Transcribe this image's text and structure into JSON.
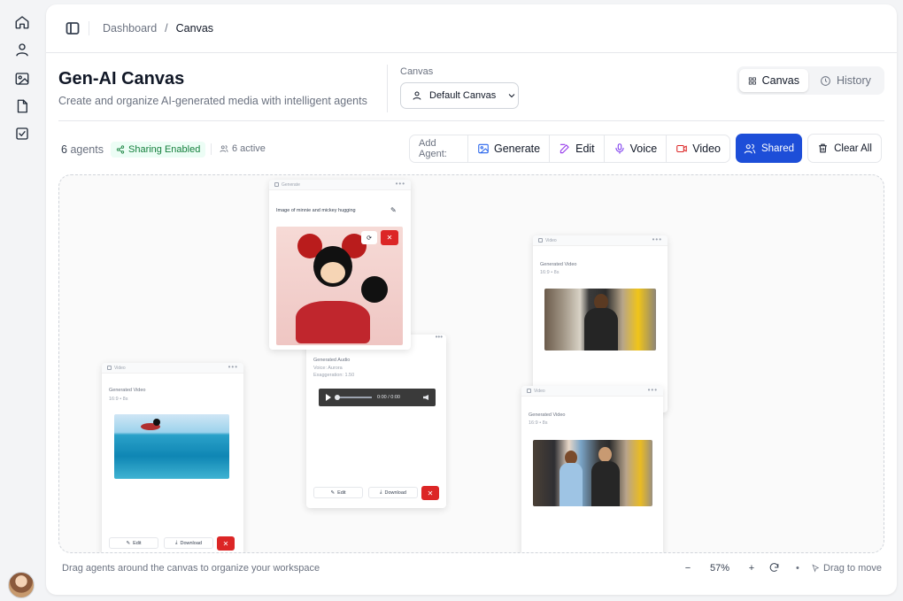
{
  "rail": {
    "icons": [
      "home-icon",
      "user-icon",
      "image-icon",
      "file-icon",
      "check-square-icon"
    ]
  },
  "breadcrumb": {
    "root": "Dashboard",
    "separator": "/",
    "current": "Canvas"
  },
  "header": {
    "title": "Gen-AI Canvas",
    "subtitle": "Create and organize AI-generated media with intelligent agents",
    "canvas_label": "Canvas",
    "canvas_selected": "Default Canvas"
  },
  "view_toggle": {
    "canvas": "Canvas",
    "history": "History",
    "active": "canvas"
  },
  "stats": {
    "agents_count": "6",
    "agents_word": "agents",
    "sharing": "Sharing Enabled",
    "active": "6 active"
  },
  "toolbar": {
    "add_agent_label": "Add Agent:",
    "buttons": [
      {
        "label": "Generate",
        "color": "#2563eb"
      },
      {
        "label": "Edit",
        "color": "#9333ea"
      },
      {
        "label": "Voice",
        "color": "#7c3aed"
      },
      {
        "label": "Video",
        "color": "#dc2626"
      }
    ],
    "shared": "Shared",
    "clear_all": "Clear All"
  },
  "cards": {
    "generate": {
      "header": "Generate",
      "prompt": "Image of minnie and mickey hugging",
      "close": "✕"
    },
    "video_left": {
      "header": "Video",
      "title": "Generated Video",
      "meta": "16:9 • 8s",
      "edit": "Edit",
      "download": "Download",
      "close": "✕"
    },
    "audio": {
      "title": "Generated Audio",
      "voice": "Voice: Aurora",
      "exaggeration": "Exaggeration: 1.50",
      "time": "0:00 / 0:00",
      "edit": "Edit",
      "download": "Download",
      "close": "✕"
    },
    "video_right_top": {
      "header": "Video",
      "title": "Generated Video",
      "meta": "16:9 • 8s"
    },
    "video_right_bottom": {
      "header": "Video",
      "title": "Generated Video",
      "meta": "16:9 • 8s"
    }
  },
  "footer": {
    "hint": "Drag agents around the canvas to organize your workspace",
    "zoom_out": "−",
    "zoom": "57%",
    "zoom_in": "+",
    "dot": "•",
    "drag": "Drag to move"
  }
}
